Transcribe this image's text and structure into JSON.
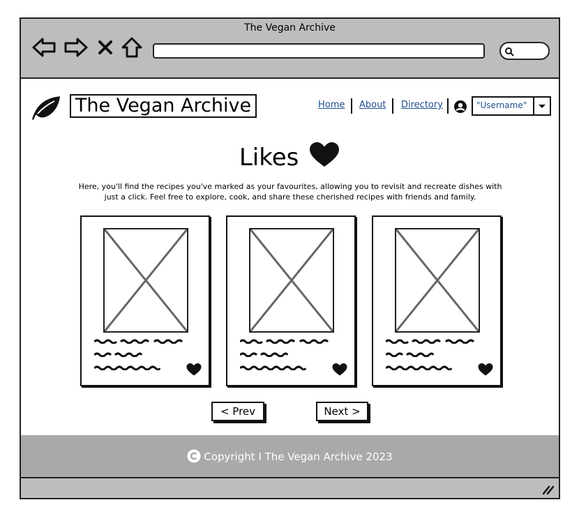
{
  "browser": {
    "title": "The Vegan Archive",
    "url": "",
    "search": ""
  },
  "site": {
    "title": "The Vegan Archive",
    "nav": {
      "home": "Home",
      "about": "About",
      "directory": "Directory"
    },
    "user_select": "\"Username\""
  },
  "page": {
    "heading": "Likes",
    "intro": "Here, you'll find the recipes you've marked as your favourites, allowing you to revisit and recreate dishes with just a click. Feel free to explore, cook, and share these cherished recipes with friends and family."
  },
  "cards": [
    {
      "image": "placeholder-image",
      "liked": true
    },
    {
      "image": "placeholder-image",
      "liked": true
    },
    {
      "image": "placeholder-image",
      "liked": true
    }
  ],
  "pager": {
    "prev": "< Prev",
    "next": "Next >"
  },
  "footer": {
    "text": "Copyright I The Vegan Archive 2023"
  },
  "colors": {
    "chrome": "#bdbdbd",
    "footer": "#a9a9a9",
    "link": "#1d4d8c"
  }
}
